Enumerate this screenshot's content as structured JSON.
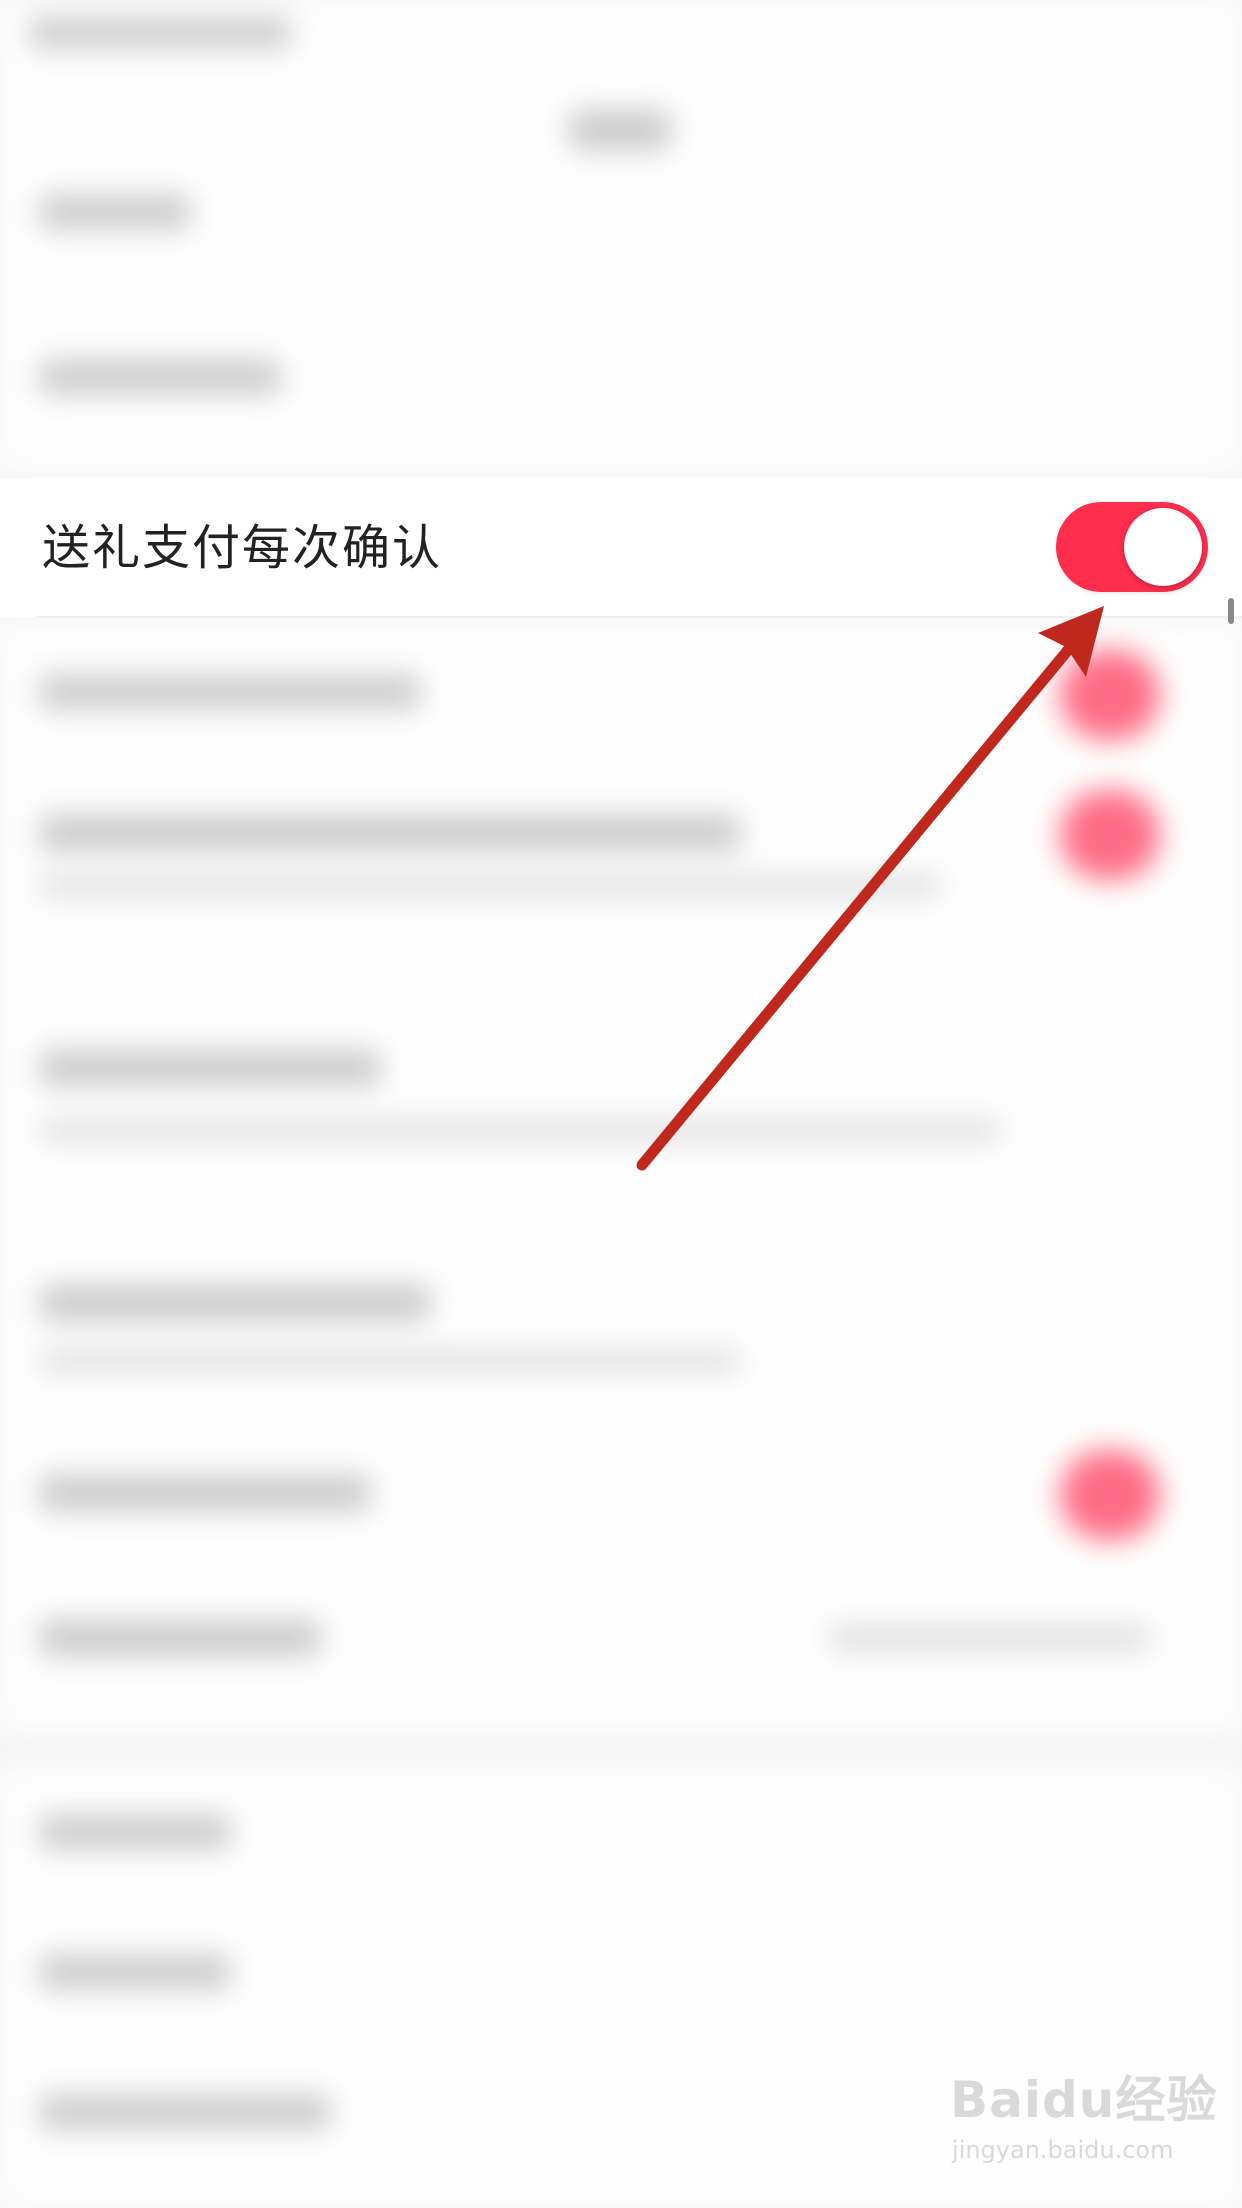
{
  "setting": {
    "label": "送礼支付每次确认",
    "toggle_on": true
  },
  "colors": {
    "toggle_on": "#ff2e4c",
    "arrow": "#c0281e",
    "background": "#f5f5f5"
  },
  "watermark": {
    "logo": "Baidu经验",
    "url": "jingyan.baidu.com"
  },
  "icons": {
    "arrow": "arrow-annotation-icon"
  }
}
